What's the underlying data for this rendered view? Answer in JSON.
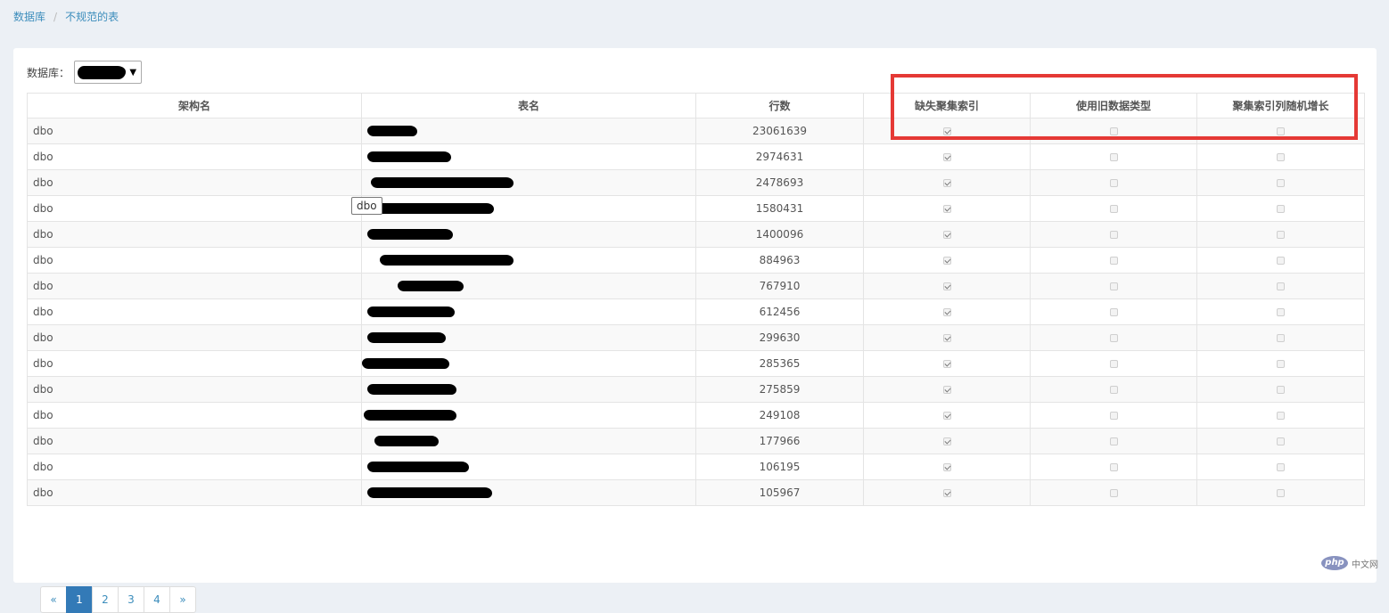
{
  "breadcrumb": {
    "root": "数据库",
    "separator": "/",
    "current": "不规范的表"
  },
  "filter": {
    "label": "数据库："
  },
  "table": {
    "headers": [
      "架构名",
      "表名",
      "行数",
      "缺失聚集索引",
      "使用旧数据类型",
      "聚集索引列随机增长"
    ],
    "rows": [
      {
        "schema": "dbo",
        "rows": "23061639",
        "missing_clustered": true,
        "old_types": false,
        "random_growth": false
      },
      {
        "schema": "dbo",
        "rows": "2974631",
        "missing_clustered": true,
        "old_types": false,
        "random_growth": false
      },
      {
        "schema": "dbo",
        "rows": "2478693",
        "missing_clustered": true,
        "old_types": false,
        "random_growth": false
      },
      {
        "schema": "dbo",
        "rows": "1580431",
        "missing_clustered": true,
        "old_types": false,
        "random_growth": false
      },
      {
        "schema": "dbo",
        "rows": "1400096",
        "missing_clustered": true,
        "old_types": false,
        "random_growth": false
      },
      {
        "schema": "dbo",
        "rows": "884963",
        "missing_clustered": true,
        "old_types": false,
        "random_growth": false
      },
      {
        "schema": "dbo",
        "rows": "767910",
        "missing_clustered": true,
        "old_types": false,
        "random_growth": false
      },
      {
        "schema": "dbo",
        "rows": "612456",
        "missing_clustered": true,
        "old_types": false,
        "random_growth": false
      },
      {
        "schema": "dbo",
        "rows": "299630",
        "missing_clustered": true,
        "old_types": false,
        "random_growth": false
      },
      {
        "schema": "dbo",
        "rows": "285365",
        "missing_clustered": true,
        "old_types": false,
        "random_growth": false
      },
      {
        "schema": "dbo",
        "rows": "275859",
        "missing_clustered": true,
        "old_types": false,
        "random_growth": false
      },
      {
        "schema": "dbo",
        "rows": "249108",
        "missing_clustered": true,
        "old_types": false,
        "random_growth": false
      },
      {
        "schema": "dbo",
        "rows": "177966",
        "missing_clustered": true,
        "old_types": false,
        "random_growth": false
      },
      {
        "schema": "dbo",
        "rows": "106195",
        "missing_clustered": true,
        "old_types": false,
        "random_growth": false
      },
      {
        "schema": "dbo",
        "rows": "105967",
        "missing_clustered": true,
        "old_types": false,
        "random_growth": false
      }
    ]
  },
  "tooltip": "dbo",
  "pagination": {
    "prev": "«",
    "pages": [
      "1",
      "2",
      "3",
      "4"
    ],
    "next": "»",
    "active": "1"
  },
  "watermark": {
    "logo": "php",
    "text": "中文网"
  },
  "colors": {
    "link": "#3c8dbc",
    "highlight_box": "#e53935",
    "active_page": "#337ab7"
  }
}
